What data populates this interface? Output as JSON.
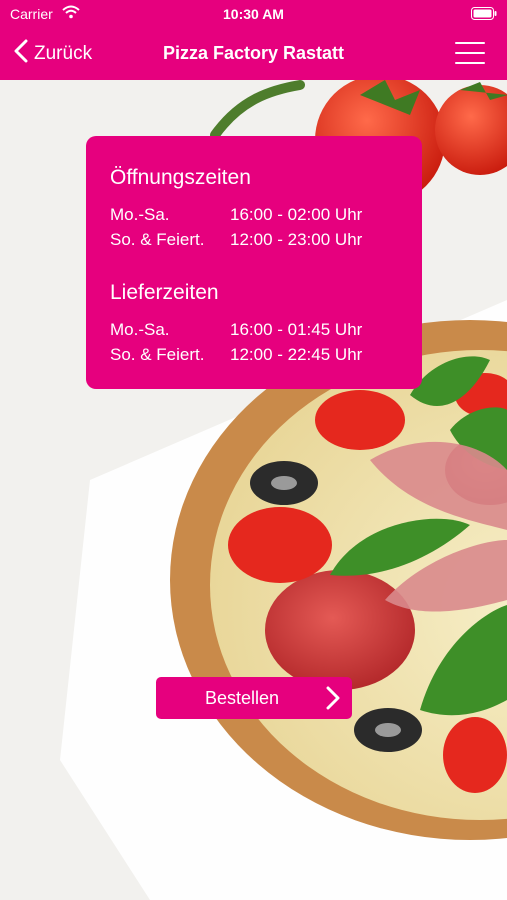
{
  "status_bar": {
    "carrier": "Carrier",
    "time": "10:30 AM",
    "icons": [
      "wifi-icon",
      "battery-icon"
    ]
  },
  "nav": {
    "back_label": "Zurück",
    "title": "Pizza Factory Rastatt",
    "menu_icon": "hamburger-menu-icon"
  },
  "hours": {
    "opening_title": "Öffnungszeiten",
    "opening": [
      {
        "day": "Mo.-Sa.",
        "time": "16:00 - 02:00 Uhr"
      },
      {
        "day": "So. & Feiert.",
        "time": "12:00 - 23:00 Uhr"
      }
    ],
    "delivery_title": "Lieferzeiten",
    "delivery": [
      {
        "day": "Mo.-Sa.",
        "time": "16:00 - 01:45 Uhr"
      },
      {
        "day": "So. & Feiert.",
        "time": "12:00 - 22:45 Uhr"
      }
    ]
  },
  "order_button": {
    "label": "Bestellen",
    "icon": "chevron-right-icon"
  },
  "colors": {
    "brand": "#e6007e"
  }
}
